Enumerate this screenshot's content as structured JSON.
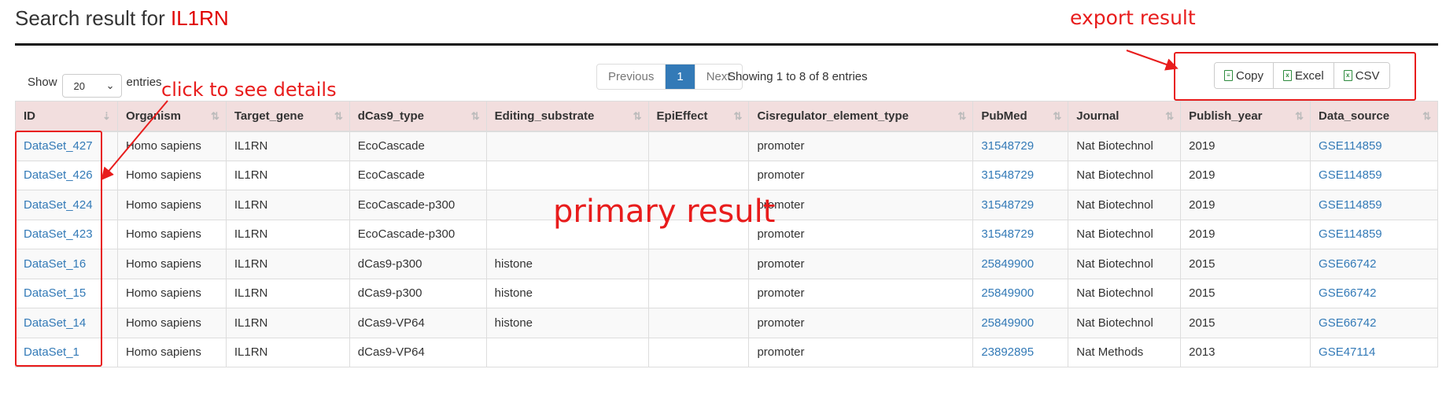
{
  "header": {
    "title_prefix": "Search result for ",
    "query": "IL1RN"
  },
  "length": {
    "show": "Show",
    "value": "20",
    "entries": "entries"
  },
  "pagination": {
    "previous": "Previous",
    "current": "1",
    "next": "Next"
  },
  "info": "Showing 1 to 8 of 8 entries",
  "export": {
    "copy": "Copy",
    "excel": "Excel",
    "csv": "CSV"
  },
  "annotations": {
    "details": "click to see details",
    "primary": "primary result",
    "export": "export result"
  },
  "table": {
    "columns": [
      "ID",
      "Organism",
      "Target_gene",
      "dCas9_type",
      "Editing_substrate",
      "EpiEffect",
      "Cisregulator_element_type",
      "PubMed",
      "Journal",
      "Publish_year",
      "Data_source"
    ],
    "rows": [
      [
        "DataSet_427",
        "Homo sapiens",
        "IL1RN",
        "EcoCascade",
        "",
        "",
        "promoter",
        "31548729",
        "Nat Biotechnol",
        "2019",
        "GSE114859"
      ],
      [
        "DataSet_426",
        "Homo sapiens",
        "IL1RN",
        "EcoCascade",
        "",
        "",
        "promoter",
        "31548729",
        "Nat Biotechnol",
        "2019",
        "GSE114859"
      ],
      [
        "DataSet_424",
        "Homo sapiens",
        "IL1RN",
        "EcoCascade-p300",
        "",
        "",
        "promoter",
        "31548729",
        "Nat Biotechnol",
        "2019",
        "GSE114859"
      ],
      [
        "DataSet_423",
        "Homo sapiens",
        "IL1RN",
        "EcoCascade-p300",
        "",
        "",
        "promoter",
        "31548729",
        "Nat Biotechnol",
        "2019",
        "GSE114859"
      ],
      [
        "DataSet_16",
        "Homo sapiens",
        "IL1RN",
        "dCas9-p300",
        "histone",
        "",
        "promoter",
        "25849900",
        "Nat Biotechnol",
        "2015",
        "GSE66742"
      ],
      [
        "DataSet_15",
        "Homo sapiens",
        "IL1RN",
        "dCas9-p300",
        "histone",
        "",
        "promoter",
        "25849900",
        "Nat Biotechnol",
        "2015",
        "GSE66742"
      ],
      [
        "DataSet_14",
        "Homo sapiens",
        "IL1RN",
        "dCas9-VP64",
        "histone",
        "",
        "promoter",
        "25849900",
        "Nat Biotechnol",
        "2015",
        "GSE66742"
      ],
      [
        "DataSet_1",
        "Homo sapiens",
        "IL1RN",
        "dCas9-VP64",
        "",
        "",
        "promoter",
        "23892895",
        "Nat Methods",
        "2013",
        "GSE47114"
      ]
    ]
  },
  "colors": {
    "link": "#337ab7",
    "header_bg": "#f2dede",
    "annotation": "#e81c1c",
    "query": "#e00000"
  }
}
